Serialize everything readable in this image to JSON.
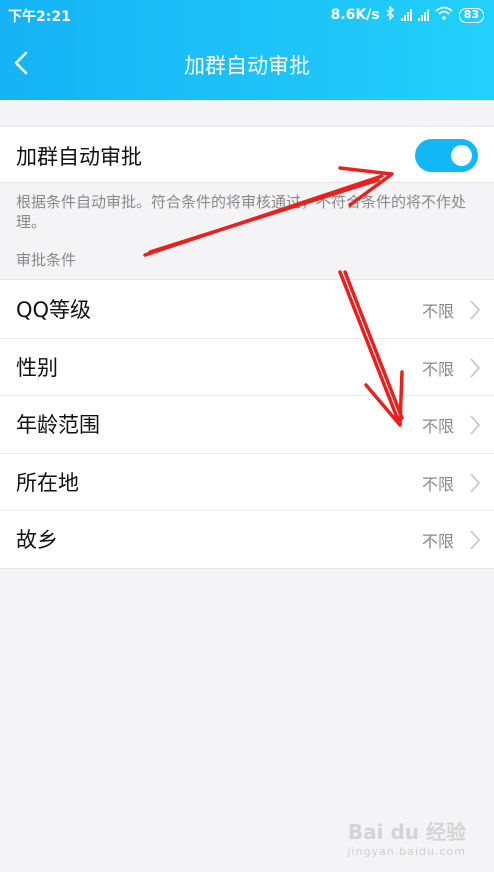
{
  "status_bar": {
    "time": "下午2:21",
    "network_speed": "8.6K/s",
    "battery": "83",
    "icons": [
      "bluetooth-icon",
      "signal-icon",
      "wifi-icon",
      "battery-icon"
    ]
  },
  "header": {
    "title": "加群自动审批",
    "back_icon": "chevron-left-icon"
  },
  "auto_approve": {
    "label": "加群自动审批",
    "enabled": true
  },
  "description": "根据条件自动审批。符合条件的将审核通过，不符合条件的将不作处理。",
  "conditions": {
    "section_label": "审批条件",
    "items": [
      {
        "label": "QQ等级",
        "value": "不限"
      },
      {
        "label": "性别",
        "value": "不限"
      },
      {
        "label": "年龄范围",
        "value": "不限"
      },
      {
        "label": "所在地",
        "value": "不限"
      },
      {
        "label": "故乡",
        "value": "不限"
      }
    ]
  },
  "watermark": {
    "brand": "Bai du 经验",
    "site": "jingyan.baidu.com"
  },
  "colors": {
    "header": "#1ec4f8",
    "switch_on": "#12b7f5",
    "annotation_arrow": "#e8201e"
  }
}
